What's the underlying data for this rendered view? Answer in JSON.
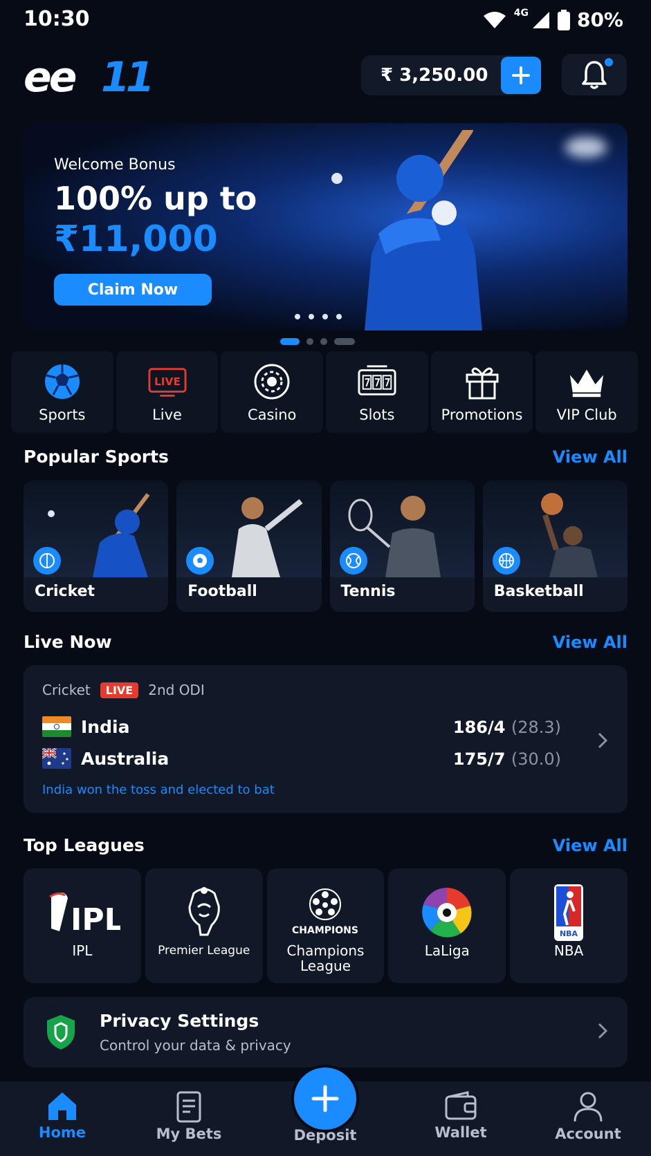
{
  "status_bar": {
    "time": "10:30",
    "network": "4G",
    "battery": "80%"
  },
  "header": {
    "logo_text": "ee11",
    "balance": "₹ 3,250.00",
    "icons": [
      "plus-icon",
      "bell-icon"
    ],
    "accent": "#1a8cff"
  },
  "banner": {
    "kicker": "Welcome Bonus",
    "headline": "100% up to",
    "amount": "₹11,000",
    "cta": "Claim Now"
  },
  "categories": [
    {
      "label": "Sports",
      "icon": "soccer-ball-icon"
    },
    {
      "label": "Live",
      "icon": "live-tv-icon"
    },
    {
      "label": "Casino",
      "icon": "casino-chip-icon"
    },
    {
      "label": "Slots",
      "icon": "slot-machine-icon"
    },
    {
      "label": "Promotions",
      "icon": "gift-icon"
    },
    {
      "label": "VIP Club",
      "icon": "crown-icon"
    }
  ],
  "live_icon_text": "LIVE",
  "popular_sports": {
    "title": "Popular Sports",
    "view_all": "View All",
    "items": [
      {
        "label": "Cricket",
        "icon": "cricket-ball-icon"
      },
      {
        "label": "Football",
        "icon": "football-icon"
      },
      {
        "label": "Tennis",
        "icon": "tennis-ball-icon"
      },
      {
        "label": "Basketball",
        "icon": "basketball-icon"
      }
    ]
  },
  "live_now": {
    "title": "Live Now",
    "view_all": "View All",
    "match": {
      "sport": "Cricket",
      "badge": "LIVE",
      "stage": "2nd ODI",
      "teams": [
        {
          "name": "India",
          "score": "186/4",
          "overs": "(28.3)"
        },
        {
          "name": "Australia",
          "score": "175/7",
          "overs": "(30.0)"
        }
      ],
      "note": "India won the toss and elected to bat"
    }
  },
  "top_leagues": {
    "title": "Top Leagues",
    "view_all": "View All",
    "items": [
      {
        "label": "IPL",
        "logo_text": "IPL"
      },
      {
        "label": "Premier League",
        "logo_text": ""
      },
      {
        "label": "Champions League",
        "logo_text": "CHAMPIONS"
      },
      {
        "label": "LaLiga",
        "logo_text": ""
      },
      {
        "label": "NBA",
        "logo_text": "NBA"
      }
    ]
  },
  "privacy": {
    "title": "Privacy Settings",
    "subtitle": "Control your data & privacy"
  },
  "bottom_nav": [
    {
      "label": "Home",
      "icon": "home-icon",
      "active": true
    },
    {
      "label": "My Bets",
      "icon": "bet-slip-icon"
    },
    {
      "label": "Deposit",
      "icon": "plus-icon"
    },
    {
      "label": "Wallet",
      "icon": "wallet-icon"
    },
    {
      "label": "Account",
      "icon": "user-icon"
    }
  ]
}
